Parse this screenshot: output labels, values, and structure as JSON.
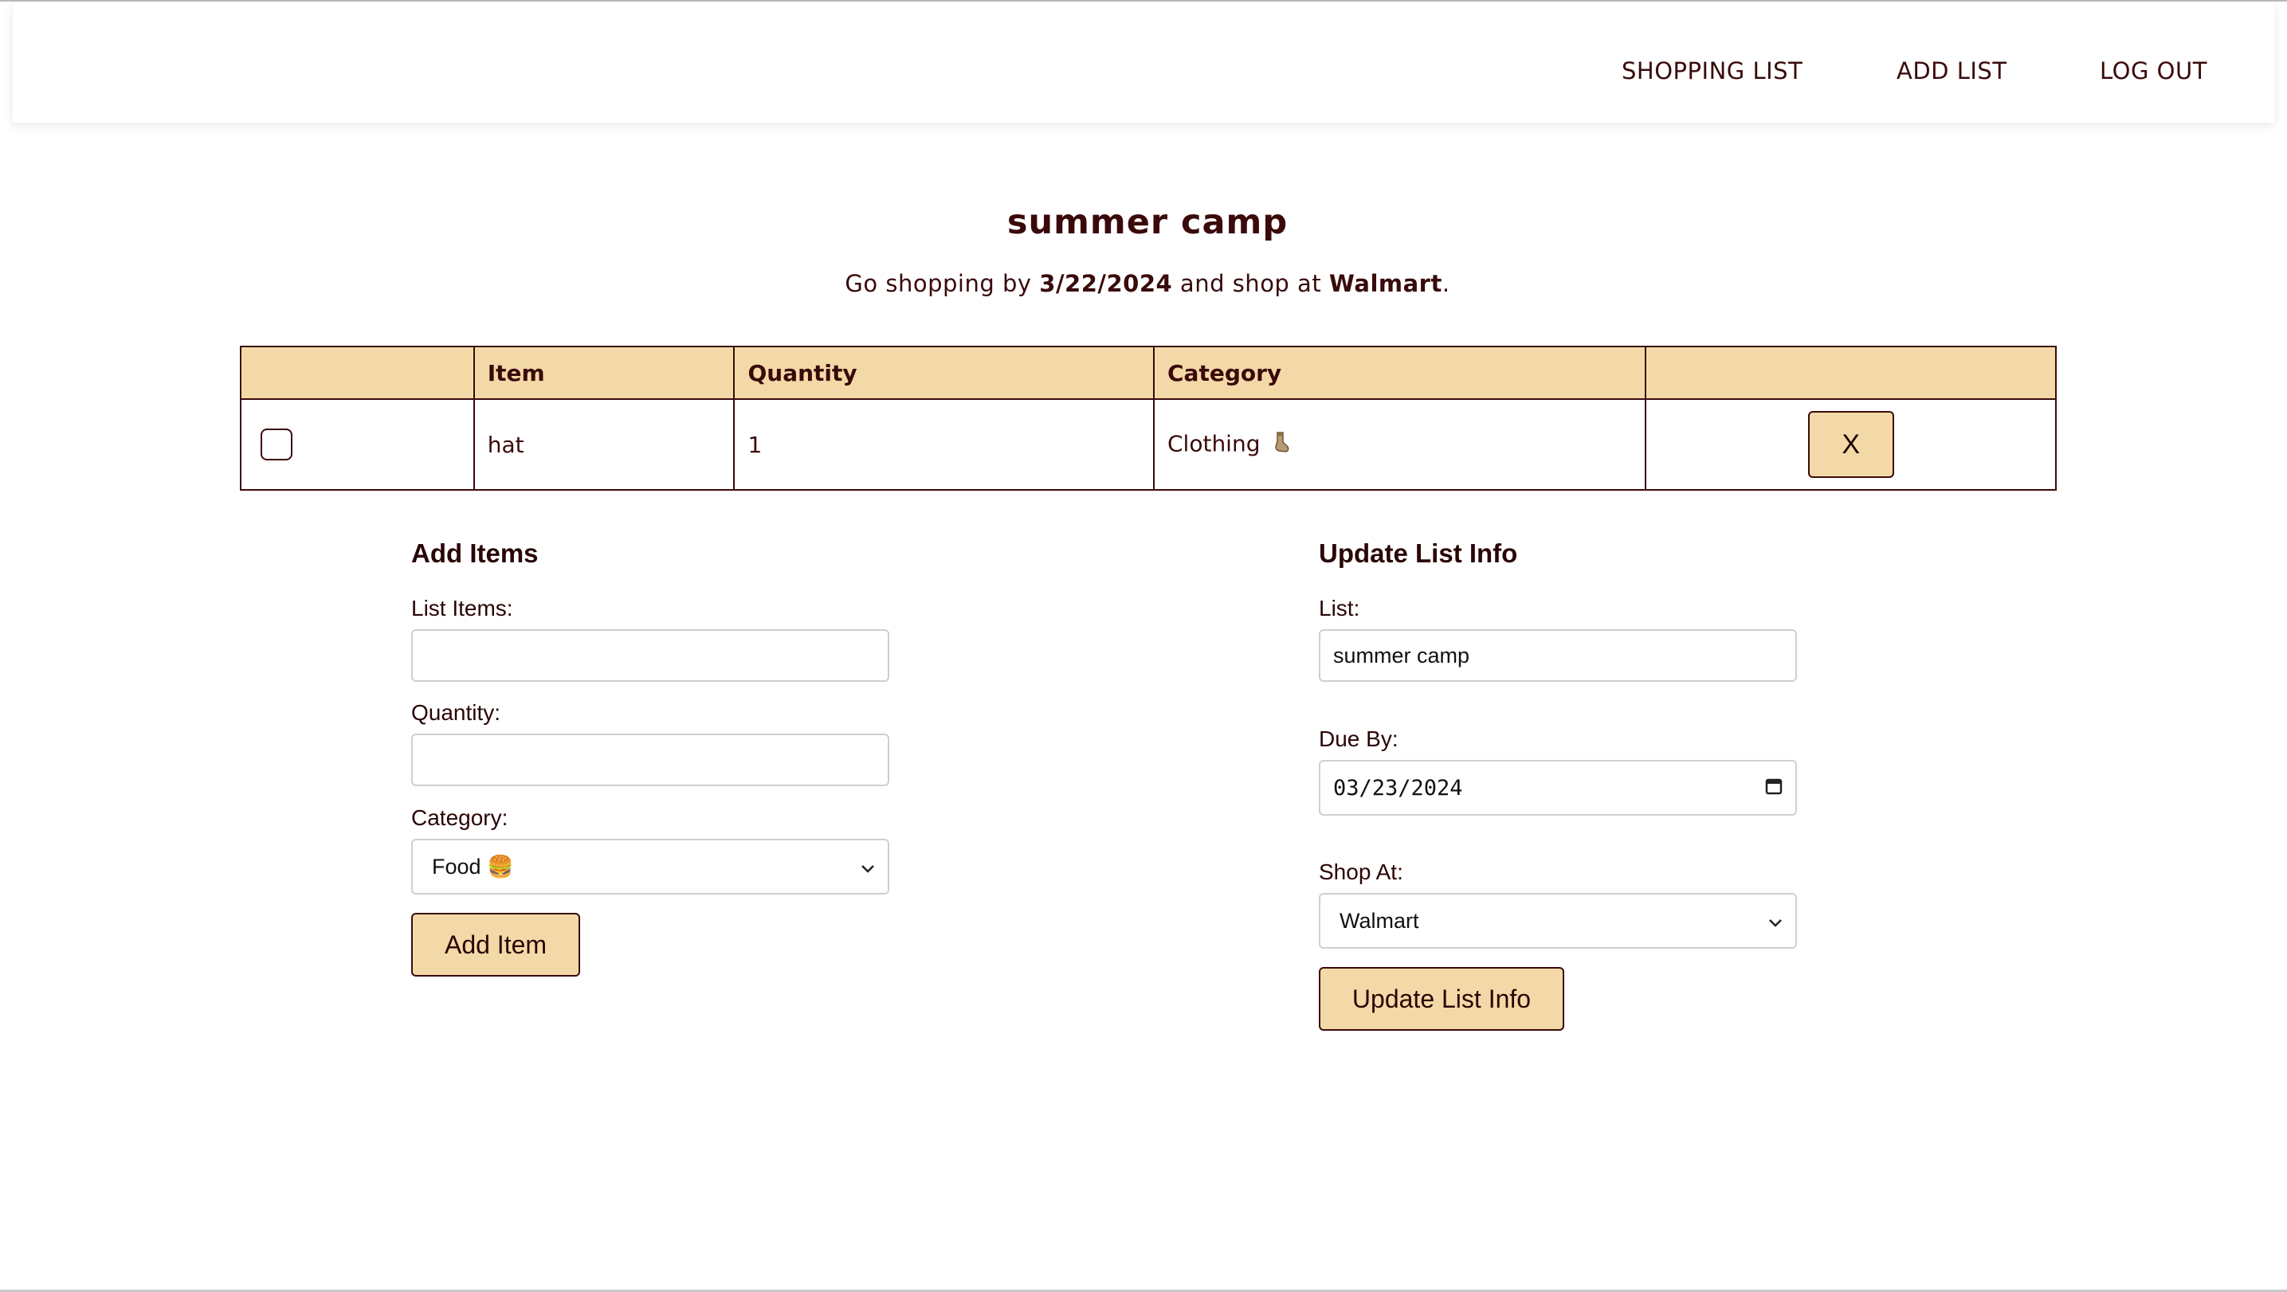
{
  "nav": {
    "shopping_list": "SHOPPING LIST",
    "add_list": "ADD LIST",
    "log_out": "LOG OUT"
  },
  "list": {
    "title": "summer camp",
    "subtitle_prefix": "Go shopping by ",
    "due_date": "3/22/2024",
    "subtitle_middle": " and shop at ",
    "store": "Walmart",
    "subtitle_suffix": "."
  },
  "table": {
    "headers": [
      "",
      "Item",
      "Quantity",
      "Category",
      ""
    ],
    "rows": [
      {
        "checked": false,
        "item": "hat",
        "quantity": "1",
        "category": "Clothing",
        "category_icon": "socks-icon",
        "delete_label": "X"
      }
    ]
  },
  "add_items": {
    "heading": "Add Items",
    "list_items_label": "List Items:",
    "list_items_value": "",
    "quantity_label": "Quantity:",
    "quantity_value": "",
    "category_label": "Category:",
    "category_selected": "Food 🍔",
    "submit_label": "Add Item"
  },
  "update_list": {
    "heading": "Update List Info",
    "list_label": "List:",
    "list_value": "summer camp",
    "due_label": "Due By:",
    "due_value": "03/23/2024",
    "shop_label": "Shop At:",
    "shop_selected": "Walmart",
    "submit_label": "Update List Info"
  },
  "colors": {
    "accent": "#f3d9a7",
    "text": "#3a0a0a",
    "border": "#3a0a0a"
  }
}
